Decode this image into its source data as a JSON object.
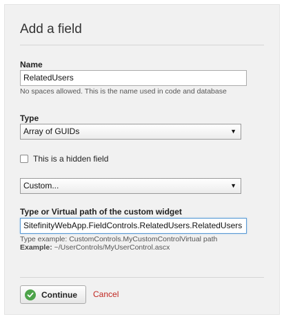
{
  "dialog": {
    "title": "Add a field"
  },
  "name_field": {
    "label": "Name",
    "value": "RelatedUsers",
    "hint": "No spaces allowed. This is the name used in code and database"
  },
  "type_field": {
    "label": "Type",
    "selected": "Array of GUIDs"
  },
  "hidden_checkbox": {
    "label": "This is a hidden field",
    "checked": false
  },
  "widget_select": {
    "selected": "Custom..."
  },
  "widget_path_field": {
    "label": "Type or Virtual path of the custom widget",
    "value": "SitefinityWebApp.FieldControls.RelatedUsers.RelatedUsers",
    "hint_type_example": "Type example: CustomControls.MyCustomControlVirtual path",
    "hint_example_label": "Example:",
    "hint_example_value": " ~/UserControls/MyUserControl.ascx"
  },
  "actions": {
    "continue_label": "Continue",
    "cancel_label": "Cancel"
  },
  "colors": {
    "accent_green": "#4da34a",
    "cancel_red": "#c0251f",
    "focus_blue": "#5b9bd5"
  }
}
